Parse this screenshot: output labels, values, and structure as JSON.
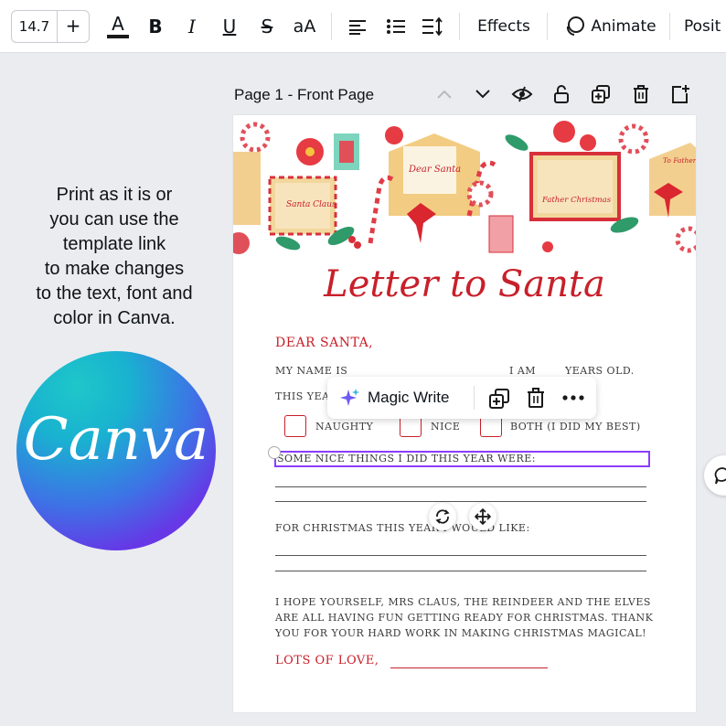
{
  "toolbar": {
    "font_size": "14.7",
    "plus": "+",
    "text_color_glyph": "A",
    "bold": "B",
    "italic": "I",
    "underline": "U",
    "strike": "S",
    "case": "aA",
    "effects": "Effects",
    "animate": "Animate",
    "position": "Posit"
  },
  "promo": {
    "lines": [
      "Print as it is or",
      "you can use the",
      "template link",
      "to make changes",
      "to the text, font and",
      "color in Canva."
    ],
    "logo_text": "Canva"
  },
  "page_header": {
    "title": "Page 1 - Front Page"
  },
  "letter": {
    "title": "Letter to Santa",
    "dear": "DEAR SANTA,",
    "name_label": "MY NAME IS",
    "i_am": "I AM",
    "years_old": "YEARS OLD.",
    "this_year": "THIS YEA",
    "naughty": "NAUGHTY",
    "nice": "NICE",
    "both": "BOTH (I DID MY BEST)",
    "nice_things": "SOME NICE THINGS I DID THIS YEAR WERE:",
    "christmas_like": "FOR CHRISTMAS THIS YEAR I WOULD LIKE:",
    "hope1": "I HOPE YOURSELF, MRS CLAUS, THE REINDEER AND THE ELVES",
    "hope2": "ARE ALL HAVING FUN GETTING READY FOR CHRISTMAS. THANK",
    "hope3": "YOU FOR YOUR HARD WORK IN MAKING CHRISTMAS MAGICAL!",
    "lots_of_love": "LOTS OF LOVE,",
    "banner_text": {
      "dear_santa_env": "Dear Santa",
      "santa_claus_env": "Santa Claus",
      "father_christmas_env": "Father Christmas",
      "to_father_christmas": "To Father Christmas"
    }
  },
  "magic_menu": {
    "label": "Magic Write"
  },
  "colors": {
    "accent": "#8b3dff",
    "letter_red": "#c8202a",
    "canvas_bg": "#ebecf0"
  }
}
